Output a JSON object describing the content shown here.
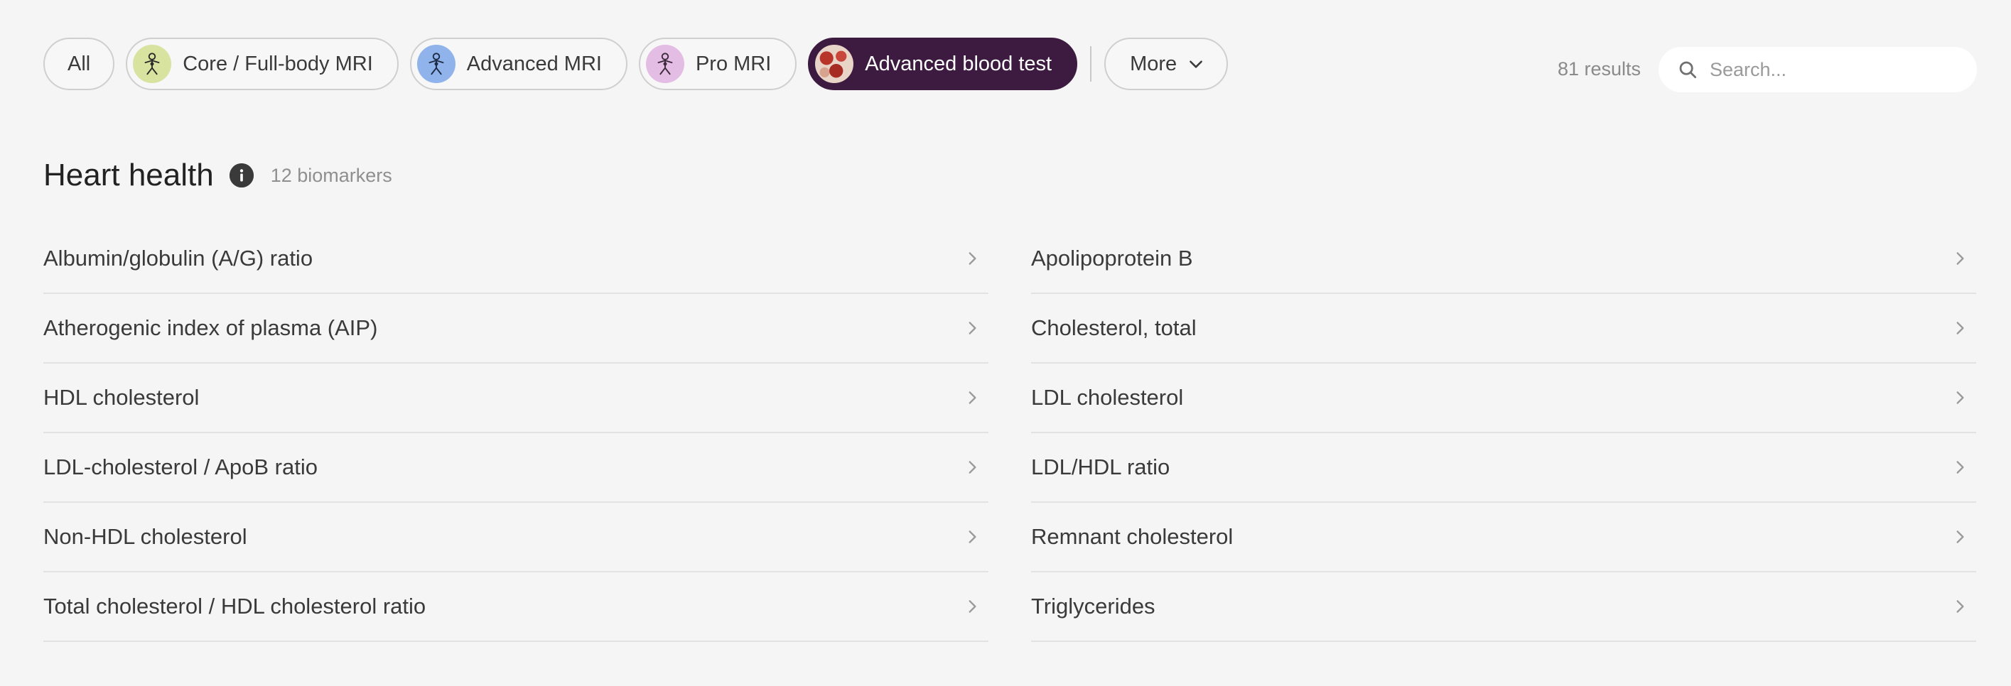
{
  "filters": {
    "all_label": "All",
    "core_label": "Core / Full-body MRI",
    "advanced_mri_label": "Advanced MRI",
    "pro_mri_label": "Pro MRI",
    "blood_test_label": "Advanced blood test",
    "more_label": "More",
    "active": "Advanced blood test"
  },
  "results": {
    "count_text": "81 results"
  },
  "search": {
    "placeholder": "Search..."
  },
  "section": {
    "title": "Heart health",
    "count_text": "12 biomarkers"
  },
  "biomarkers": {
    "left": [
      "Albumin/globulin (A/G) ratio",
      "Atherogenic index of plasma (AIP)",
      "HDL cholesterol",
      "LDL-cholesterol / ApoB ratio",
      "Non-HDL cholesterol",
      "Total cholesterol / HDL cholesterol ratio"
    ],
    "right": [
      "Apolipoprotein B",
      "Cholesterol, total",
      "LDL cholesterol",
      "LDL/HDL ratio",
      "Remnant cholesterol",
      "Triglycerides"
    ]
  },
  "colors": {
    "background": "#f5f5f5",
    "active_chip": "#3d1b40",
    "core_icon_bg": "#d9e3a0",
    "advanced_icon_bg": "#8fb3ea",
    "pro_icon_bg": "#e3bde3"
  },
  "icons": {
    "core": "person-body-icon",
    "advanced_mri": "person-body-icon",
    "pro_mri": "person-body-icon",
    "blood_test": "blood-cells-icon",
    "more": "chevron-down-icon",
    "search": "search-icon",
    "info": "info-icon",
    "row": "chevron-right-icon"
  }
}
